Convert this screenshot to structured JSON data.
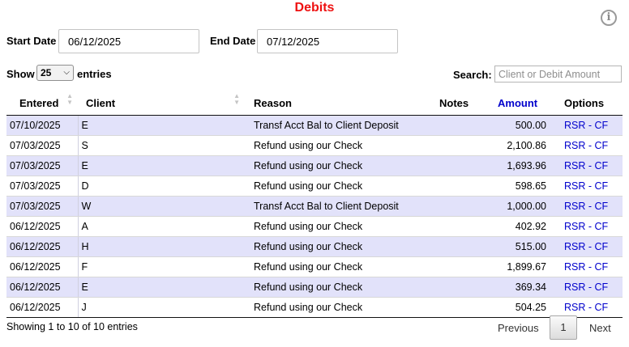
{
  "title": "Debits",
  "filters": {
    "start_label": "Start Date",
    "start_value": "06/12/2025",
    "end_label": "End Date",
    "end_value": "07/12/2025"
  },
  "length": {
    "show_label": "Show",
    "value": "25",
    "entries_label": "entries"
  },
  "search": {
    "label": "Search:",
    "placeholder": "Client or Debit Amount"
  },
  "columns": {
    "entered": "Entered",
    "client": "Client",
    "reason": "Reason",
    "notes": "Notes",
    "amount": "Amount",
    "options": "Options"
  },
  "rows": [
    {
      "entered": "07/10/2025",
      "client": "E",
      "reason": "Transf Acct Bal to Client Deposit",
      "notes": "",
      "amount": "500.00",
      "options": "RSR - CF"
    },
    {
      "entered": "07/03/2025",
      "client": "S",
      "reason": "Refund using our Check",
      "notes": "",
      "amount": "2,100.86",
      "options": "RSR - CF"
    },
    {
      "entered": "07/03/2025",
      "client": "E",
      "reason": "Refund using our Check",
      "notes": "",
      "amount": "1,693.96",
      "options": "RSR - CF"
    },
    {
      "entered": "07/03/2025",
      "client": "D",
      "reason": "Refund using our Check",
      "notes": "",
      "amount": "598.65",
      "options": "RSR - CF"
    },
    {
      "entered": "07/03/2025",
      "client": "W",
      "reason": "Transf Acct Bal to Client Deposit",
      "notes": "",
      "amount": "1,000.00",
      "options": "RSR - CF"
    },
    {
      "entered": "06/12/2025",
      "client": "A",
      "reason": "Refund using our Check",
      "notes": "",
      "amount": "402.92",
      "options": "RSR - CF"
    },
    {
      "entered": "06/12/2025",
      "client": "H",
      "reason": "Refund using our Check",
      "notes": "",
      "amount": "515.00",
      "options": "RSR - CF"
    },
    {
      "entered": "06/12/2025",
      "client": "F",
      "reason": "Refund using our Check",
      "notes": "",
      "amount": "1,899.67",
      "options": "RSR - CF"
    },
    {
      "entered": "06/12/2025",
      "client": "E",
      "reason": "Refund using our Check",
      "notes": "",
      "amount": "369.34",
      "options": "RSR - CF"
    },
    {
      "entered": "06/12/2025",
      "client": "J",
      "reason": "Refund using our Check",
      "notes": "",
      "amount": "504.25",
      "options": "RSR - CF"
    }
  ],
  "footer": {
    "info": "Showing 1 to 10 of 10 entries",
    "previous": "Previous",
    "current_page": "1",
    "next": "Next"
  },
  "icons": {
    "info": "info-icon",
    "sort": "sort-icon",
    "dropdown": "chevron-down-icon"
  },
  "colors": {
    "title": "#ee1111",
    "odd_row": "#e2e2fa",
    "link": "#0000cc",
    "sorted_header": "#0000cc"
  }
}
